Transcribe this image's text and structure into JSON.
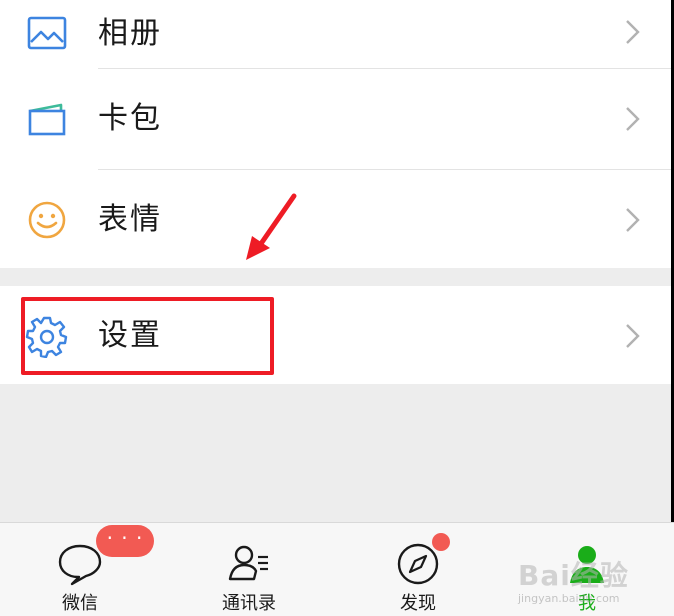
{
  "menu": {
    "items": [
      {
        "label": "相册",
        "icon": "photo-album-icon"
      },
      {
        "label": "卡包",
        "icon": "card-wallet-icon"
      },
      {
        "label": "表情",
        "icon": "smiley-face-icon"
      },
      {
        "label": "设置",
        "icon": "gear-icon"
      }
    ]
  },
  "tabbar": {
    "tabs": [
      {
        "label": "微信",
        "icon": "chat-bubble-icon",
        "active": false
      },
      {
        "label": "通讯录",
        "icon": "contacts-icon",
        "active": false
      },
      {
        "label": "发现",
        "icon": "compass-icon",
        "active": false
      },
      {
        "label": "我",
        "icon": "person-icon",
        "active": true
      }
    ],
    "chat_badge": "· · ·"
  },
  "watermark": {
    "brand": "Bai经验",
    "site": "jingyan.baidu.com"
  },
  "colors": {
    "accent_green": "#1aad19",
    "badge_red": "#f25a53",
    "annotation_red": "#ee1c25",
    "icon_blue": "#3d84e0",
    "emoji_orange": "#f0a640"
  }
}
